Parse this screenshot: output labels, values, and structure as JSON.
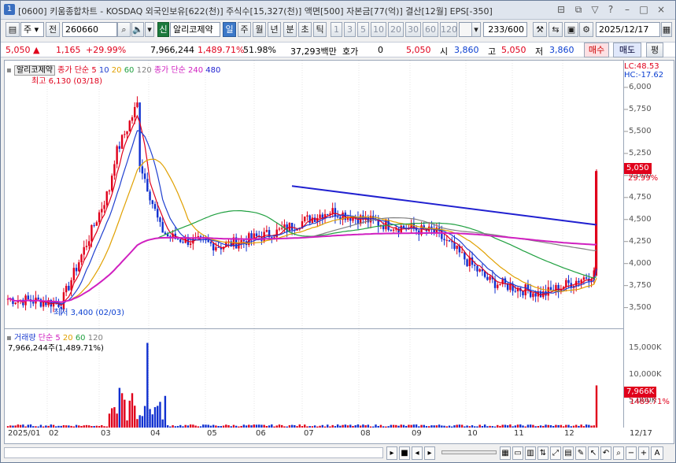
{
  "window": {
    "number": "1",
    "title": "[0600] 키움종합차트 - KOSDAQ 외국인보유[622(천)] 주식수[15,327(천)] 액면[500] 자본금[77(억)] 결산[12월] EPS[-350]",
    "controls": [
      "⊟",
      "⧉",
      "▽",
      "?",
      "–",
      "□",
      "×"
    ]
  },
  "toolbar": {
    "type": "주",
    "type_arrow": "▾",
    "adj": "전",
    "code": "260660",
    "search_icon": "⌕",
    "dropdown_arrow": "▾",
    "sound_icon": "🔈",
    "new_tag": "신",
    "stock_name": "알리코제약",
    "periods": [
      "일",
      "주",
      "월",
      "년",
      "분",
      "초",
      "틱"
    ],
    "active_period": "일",
    "intervals": [
      "1",
      "3",
      "5",
      "10",
      "20",
      "30",
      "60",
      "120"
    ],
    "count": "233/600",
    "date": "2025/12/17"
  },
  "quote": {
    "price": "5,050",
    "arrow": "▲",
    "change": "1,165",
    "change_pct": "+29.99%",
    "volume": "7,966,244",
    "vol_pct": "1,489.71%",
    "ratio": "51.98%",
    "amount": "37,293백만",
    "hoga_label": "호가",
    "hoga": "0",
    "ask": "5,050",
    "open_label": "시",
    "open": "3,860",
    "high_label": "고",
    "high": "5,050",
    "low_label": "저",
    "low": "3,860",
    "buy": "매수",
    "sell": "매도",
    "flat": "평"
  },
  "legend": {
    "name": "알리코제약",
    "ma_label": "종가 단순",
    "ma": [
      "5",
      "10",
      "20",
      "60",
      "120"
    ],
    "ma_colors": [
      "#e0001b",
      "#2040d0",
      "#e0a000",
      "#20a040",
      "#808080"
    ],
    "ma2_label": "종가 단순",
    "ma2": [
      "240",
      "480"
    ],
    "ma2_colors": [
      "#d020c0",
      "#2020d0"
    ]
  },
  "annotations": {
    "high": "최고 6,130 (03/18)",
    "low": "최저 3,400 (02/03)",
    "lc": "LC:48.53",
    "hc": "HC:-17.62"
  },
  "volume_legend": {
    "label": "거래량",
    "ma_label": "단순",
    "ma": [
      "5",
      "20",
      "60",
      "120"
    ],
    "ma_colors": [
      "#d020c0",
      "#e0a000",
      "#20a040",
      "#808080"
    ],
    "value": "7,966,244주(1,489.71%)"
  },
  "price_axis": [
    "6,000",
    "5,750",
    "5,500",
    "5,250",
    "5,000",
    "4,750",
    "4,500",
    "4,250",
    "4,000",
    "3,750",
    "3,500"
  ],
  "price_tag": {
    "price": "5,050",
    "pct": "29.99%"
  },
  "volume_axis": [
    "15,000K",
    "10,000K",
    "5,000K"
  ],
  "volume_tag": {
    "value": "7,966K",
    "pct": "1489.71%"
  },
  "x_axis": [
    "2025/01",
    "02",
    "03",
    "04",
    "05",
    "06",
    "07",
    "08",
    "09",
    "10",
    "11",
    "12",
    "12/17"
  ],
  "chart_data": {
    "type": "candlestick",
    "title": "알리코제약",
    "y_range": [
      3300,
      6250
    ],
    "annotations": {
      "max": {
        "date": "03/18",
        "value": 6130
      },
      "min": {
        "date": "02/03",
        "value": 3400
      }
    },
    "last": {
      "date": "2025/12/17",
      "open": 3860,
      "high": 5050,
      "low": 3860,
      "close": 5050,
      "volume": 7966244
    },
    "monthly_closes": [
      {
        "month": "2025/01",
        "close": 3600
      },
      {
        "month": "02",
        "close": 3550
      },
      {
        "month": "03",
        "close": 5000
      },
      {
        "month": "04",
        "close": 4300
      },
      {
        "month": "05",
        "close": 4200
      },
      {
        "month": "06",
        "close": 4350
      },
      {
        "month": "07",
        "close": 4600
      },
      {
        "month": "08",
        "close": 4450
      },
      {
        "month": "09",
        "close": 4350
      },
      {
        "month": "10",
        "close": 3800
      },
      {
        "month": "11",
        "close": 3650
      },
      {
        "month": "12",
        "close": 3900
      }
    ],
    "volume_axis_max": 15000000
  }
}
